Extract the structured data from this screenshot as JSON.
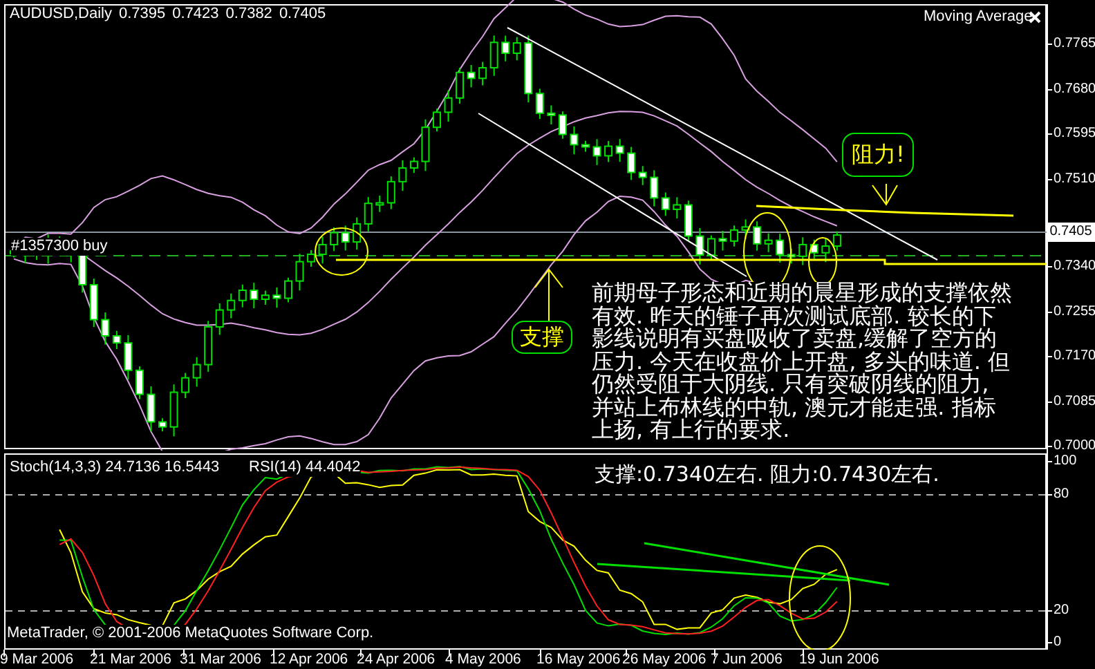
{
  "chart": {
    "symbol": "AUDUSD,Daily",
    "quote": [
      "0.7395",
      "0.7423",
      "0.7382",
      "0.7405"
    ],
    "indicator_label": "Moving Average",
    "order_label": "#1357300 buy"
  },
  "price_axis": {
    "ticks": [
      "0.7765",
      "0.7680",
      "0.7595",
      "0.7510",
      "0.7340",
      "0.7255",
      "0.7170",
      "0.7085",
      "0.7000"
    ],
    "current_price": "0.7405"
  },
  "annotations": {
    "resistance_callout": "阻力!",
    "support_callout": "支撑",
    "commentary": "前期母子形态和近期的晨星形成的支撑依然有效. 昨天的锤子再次测试底部. 较长的下影线说明有买盘吸收了卖盘,缓解了空方的压力. 今天在收盘价上开盘, 多头的味道. 但仍然受阻于大阴线. 只有突破阴线的阻力, 并站上布林线的中轨, 澳元才能走强. 指标上扬, 有上行的要求.",
    "levels": "支撑:0.7340左右. 阻力:0.7430左右."
  },
  "oscillator": {
    "stoch_label": "Stoch(14,3,3) 24.7136 16.5443",
    "rsi_label": "RSI(14) 44.4042",
    "ticks": [
      "100",
      "80",
      "20",
      "0"
    ]
  },
  "copyright": "MetaTrader, © 2001-2006 MetaQuotes Software Corp.",
  "date_axis": [
    "9 Mar 2006",
    "21 Mar 2006",
    "31 Mar 2006",
    "12 Apr 2006",
    "24 Apr 2006",
    "4 May 2006",
    "16 May 2006",
    "26 May 2006",
    "7 Jun 2006",
    "19 Jun 2006"
  ]
}
